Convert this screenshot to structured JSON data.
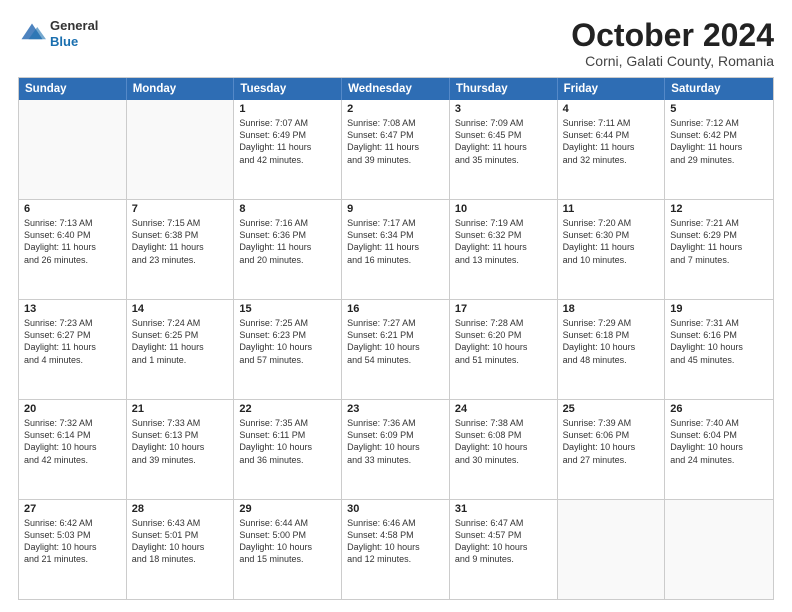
{
  "header": {
    "logo": {
      "general": "General",
      "blue": "Blue"
    },
    "month": "October 2024",
    "location": "Corni, Galati County, Romania"
  },
  "days": [
    "Sunday",
    "Monday",
    "Tuesday",
    "Wednesday",
    "Thursday",
    "Friday",
    "Saturday"
  ],
  "rows": [
    [
      {
        "day": "",
        "lines": []
      },
      {
        "day": "",
        "lines": []
      },
      {
        "day": "1",
        "lines": [
          "Sunrise: 7:07 AM",
          "Sunset: 6:49 PM",
          "Daylight: 11 hours",
          "and 42 minutes."
        ]
      },
      {
        "day": "2",
        "lines": [
          "Sunrise: 7:08 AM",
          "Sunset: 6:47 PM",
          "Daylight: 11 hours",
          "and 39 minutes."
        ]
      },
      {
        "day": "3",
        "lines": [
          "Sunrise: 7:09 AM",
          "Sunset: 6:45 PM",
          "Daylight: 11 hours",
          "and 35 minutes."
        ]
      },
      {
        "day": "4",
        "lines": [
          "Sunrise: 7:11 AM",
          "Sunset: 6:44 PM",
          "Daylight: 11 hours",
          "and 32 minutes."
        ]
      },
      {
        "day": "5",
        "lines": [
          "Sunrise: 7:12 AM",
          "Sunset: 6:42 PM",
          "Daylight: 11 hours",
          "and 29 minutes."
        ]
      }
    ],
    [
      {
        "day": "6",
        "lines": [
          "Sunrise: 7:13 AM",
          "Sunset: 6:40 PM",
          "Daylight: 11 hours",
          "and 26 minutes."
        ]
      },
      {
        "day": "7",
        "lines": [
          "Sunrise: 7:15 AM",
          "Sunset: 6:38 PM",
          "Daylight: 11 hours",
          "and 23 minutes."
        ]
      },
      {
        "day": "8",
        "lines": [
          "Sunrise: 7:16 AM",
          "Sunset: 6:36 PM",
          "Daylight: 11 hours",
          "and 20 minutes."
        ]
      },
      {
        "day": "9",
        "lines": [
          "Sunrise: 7:17 AM",
          "Sunset: 6:34 PM",
          "Daylight: 11 hours",
          "and 16 minutes."
        ]
      },
      {
        "day": "10",
        "lines": [
          "Sunrise: 7:19 AM",
          "Sunset: 6:32 PM",
          "Daylight: 11 hours",
          "and 13 minutes."
        ]
      },
      {
        "day": "11",
        "lines": [
          "Sunrise: 7:20 AM",
          "Sunset: 6:30 PM",
          "Daylight: 11 hours",
          "and 10 minutes."
        ]
      },
      {
        "day": "12",
        "lines": [
          "Sunrise: 7:21 AM",
          "Sunset: 6:29 PM",
          "Daylight: 11 hours",
          "and 7 minutes."
        ]
      }
    ],
    [
      {
        "day": "13",
        "lines": [
          "Sunrise: 7:23 AM",
          "Sunset: 6:27 PM",
          "Daylight: 11 hours",
          "and 4 minutes."
        ]
      },
      {
        "day": "14",
        "lines": [
          "Sunrise: 7:24 AM",
          "Sunset: 6:25 PM",
          "Daylight: 11 hours",
          "and 1 minute."
        ]
      },
      {
        "day": "15",
        "lines": [
          "Sunrise: 7:25 AM",
          "Sunset: 6:23 PM",
          "Daylight: 10 hours",
          "and 57 minutes."
        ]
      },
      {
        "day": "16",
        "lines": [
          "Sunrise: 7:27 AM",
          "Sunset: 6:21 PM",
          "Daylight: 10 hours",
          "and 54 minutes."
        ]
      },
      {
        "day": "17",
        "lines": [
          "Sunrise: 7:28 AM",
          "Sunset: 6:20 PM",
          "Daylight: 10 hours",
          "and 51 minutes."
        ]
      },
      {
        "day": "18",
        "lines": [
          "Sunrise: 7:29 AM",
          "Sunset: 6:18 PM",
          "Daylight: 10 hours",
          "and 48 minutes."
        ]
      },
      {
        "day": "19",
        "lines": [
          "Sunrise: 7:31 AM",
          "Sunset: 6:16 PM",
          "Daylight: 10 hours",
          "and 45 minutes."
        ]
      }
    ],
    [
      {
        "day": "20",
        "lines": [
          "Sunrise: 7:32 AM",
          "Sunset: 6:14 PM",
          "Daylight: 10 hours",
          "and 42 minutes."
        ]
      },
      {
        "day": "21",
        "lines": [
          "Sunrise: 7:33 AM",
          "Sunset: 6:13 PM",
          "Daylight: 10 hours",
          "and 39 minutes."
        ]
      },
      {
        "day": "22",
        "lines": [
          "Sunrise: 7:35 AM",
          "Sunset: 6:11 PM",
          "Daylight: 10 hours",
          "and 36 minutes."
        ]
      },
      {
        "day": "23",
        "lines": [
          "Sunrise: 7:36 AM",
          "Sunset: 6:09 PM",
          "Daylight: 10 hours",
          "and 33 minutes."
        ]
      },
      {
        "day": "24",
        "lines": [
          "Sunrise: 7:38 AM",
          "Sunset: 6:08 PM",
          "Daylight: 10 hours",
          "and 30 minutes."
        ]
      },
      {
        "day": "25",
        "lines": [
          "Sunrise: 7:39 AM",
          "Sunset: 6:06 PM",
          "Daylight: 10 hours",
          "and 27 minutes."
        ]
      },
      {
        "day": "26",
        "lines": [
          "Sunrise: 7:40 AM",
          "Sunset: 6:04 PM",
          "Daylight: 10 hours",
          "and 24 minutes."
        ]
      }
    ],
    [
      {
        "day": "27",
        "lines": [
          "Sunrise: 6:42 AM",
          "Sunset: 5:03 PM",
          "Daylight: 10 hours",
          "and 21 minutes."
        ]
      },
      {
        "day": "28",
        "lines": [
          "Sunrise: 6:43 AM",
          "Sunset: 5:01 PM",
          "Daylight: 10 hours",
          "and 18 minutes."
        ]
      },
      {
        "day": "29",
        "lines": [
          "Sunrise: 6:44 AM",
          "Sunset: 5:00 PM",
          "Daylight: 10 hours",
          "and 15 minutes."
        ]
      },
      {
        "day": "30",
        "lines": [
          "Sunrise: 6:46 AM",
          "Sunset: 4:58 PM",
          "Daylight: 10 hours",
          "and 12 minutes."
        ]
      },
      {
        "day": "31",
        "lines": [
          "Sunrise: 6:47 AM",
          "Sunset: 4:57 PM",
          "Daylight: 10 hours",
          "and 9 minutes."
        ]
      },
      {
        "day": "",
        "lines": []
      },
      {
        "day": "",
        "lines": []
      }
    ]
  ]
}
